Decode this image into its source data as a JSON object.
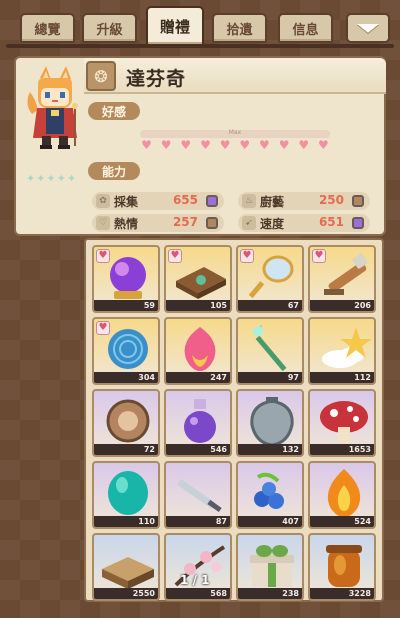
{
  "tabs": [
    {
      "label": "總覽"
    },
    {
      "label": "升級"
    },
    {
      "label": "贈禮"
    },
    {
      "label": "拾遺"
    },
    {
      "label": "信息"
    }
  ],
  "active_tab_index": 2,
  "character": {
    "name": "達芬奇",
    "star_count": 5
  },
  "affection": {
    "label": "好感",
    "max_text": "Max",
    "hearts": 10,
    "level_fraction": 1.0
  },
  "abilities": {
    "label": "能力",
    "stats": [
      {
        "label": "採集",
        "value": "655",
        "gem_color": "#9b6ed8"
      },
      {
        "label": "廚藝",
        "value": "250",
        "gem_color": "#b0875c"
      },
      {
        "label": "熱情",
        "value": "257",
        "gem_color": "#b0875c"
      },
      {
        "label": "速度",
        "value": "651",
        "gem_color": "#9b6ed8"
      }
    ]
  },
  "gifts": [
    {
      "icon": "crystal-ball-icon",
      "count": "59",
      "favorite": true,
      "bg": "#f6d98a"
    },
    {
      "icon": "spellbook-icon",
      "count": "105",
      "favorite": true,
      "bg": "#f6d98a"
    },
    {
      "icon": "hand-mirror-icon",
      "count": "67",
      "favorite": true,
      "bg": "#f6d98a"
    },
    {
      "icon": "telescope-icon",
      "count": "206",
      "favorite": true,
      "bg": "#f6d98a"
    },
    {
      "icon": "blue-yarn-ball-icon",
      "count": "304",
      "favorite": true,
      "bg": "#f6d98a"
    },
    {
      "icon": "peach-gem-icon",
      "count": "247",
      "favorite": false,
      "bg": "#f6d98a"
    },
    {
      "icon": "green-scepter-icon",
      "count": "97",
      "favorite": false,
      "bg": "#f6d98a"
    },
    {
      "icon": "cloud-star-icon",
      "count": "112",
      "favorite": false,
      "bg": "#f6d98a"
    },
    {
      "icon": "wooden-token-icon",
      "count": "72",
      "favorite": false,
      "bg": "#d9c8ea"
    },
    {
      "icon": "purple-potion-icon",
      "count": "546",
      "favorite": false,
      "bg": "#d9c8ea"
    },
    {
      "icon": "silver-locket-icon",
      "count": "132",
      "favorite": false,
      "bg": "#d9c8ea"
    },
    {
      "icon": "red-mushroom-icon",
      "count": "1653",
      "favorite": false,
      "bg": "#d9c8ea"
    },
    {
      "icon": "teal-egg-icon",
      "count": "110",
      "favorite": false,
      "bg": "#d9c8ea"
    },
    {
      "icon": "steel-sword-icon",
      "count": "87",
      "favorite": false,
      "bg": "#d9c8ea"
    },
    {
      "icon": "blue-berries-icon",
      "count": "407",
      "favorite": false,
      "bg": "#d9c8ea"
    },
    {
      "icon": "flame-gem-icon",
      "count": "524",
      "favorite": false,
      "bg": "#d9c8ea"
    },
    {
      "icon": "sand-box-icon",
      "count": "2550",
      "favorite": false,
      "bg": "#c9d6ea"
    },
    {
      "icon": "cherry-branch-icon",
      "count": "568",
      "favorite": false,
      "bg": "#c9d6ea"
    },
    {
      "icon": "gift-box-icon",
      "count": "238",
      "favorite": false,
      "bg": "#c9d6ea"
    },
    {
      "icon": "honey-jar-icon",
      "count": "3228",
      "favorite": false,
      "bg": "#c9d6ea"
    }
  ],
  "pagination": {
    "text": "1 / 1"
  }
}
